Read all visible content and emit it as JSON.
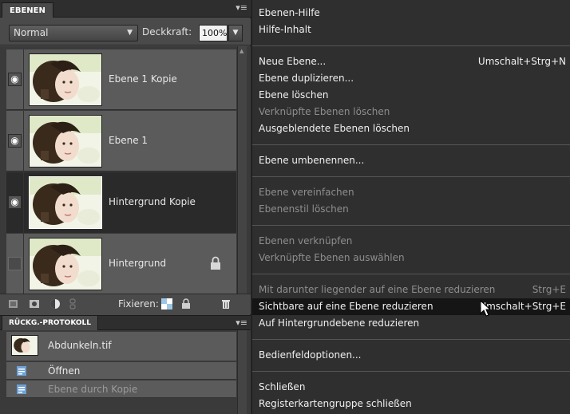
{
  "layers_panel": {
    "tab_label": "EBENEN",
    "menu_glyph": "▾≡",
    "blend_mode": "Normal",
    "opacity_label": "Deckkraft:",
    "opacity_value": "100%",
    "layers": [
      {
        "name": "Ebene 1 Kopie",
        "visible": true,
        "selected": false,
        "locked": false
      },
      {
        "name": "Ebene 1",
        "visible": true,
        "selected": false,
        "locked": false
      },
      {
        "name": "Hintergrund Kopie",
        "visible": true,
        "selected": true,
        "locked": false
      },
      {
        "name": "Hintergrund",
        "visible": false,
        "selected": false,
        "locked": true
      }
    ],
    "lock_label": "Fixieren:"
  },
  "history_panel": {
    "tab_label": "RÜCKG.-PROTOKOLL",
    "menu_glyph": "▾≡",
    "snapshot": "Abdunkeln.tif",
    "items": [
      "Öffnen",
      "Ebene durch Kopie"
    ]
  },
  "context_menu": {
    "groups": [
      [
        {
          "label": "Ebenen-Hilfe",
          "shortcut": "",
          "enabled": true
        },
        {
          "label": "Hilfe-Inhalt",
          "shortcut": "",
          "enabled": true
        }
      ],
      [
        {
          "label": "Neue Ebene...",
          "shortcut": "Umschalt+Strg+N",
          "enabled": true
        },
        {
          "label": "Ebene duplizieren...",
          "shortcut": "",
          "enabled": true
        },
        {
          "label": "Ebene löschen",
          "shortcut": "",
          "enabled": true
        },
        {
          "label": "Verknüpfte Ebenen löschen",
          "shortcut": "",
          "enabled": false
        },
        {
          "label": "Ausgeblendete Ebenen löschen",
          "shortcut": "",
          "enabled": true
        }
      ],
      [
        {
          "label": "Ebene umbenennen...",
          "shortcut": "",
          "enabled": true
        }
      ],
      [
        {
          "label": "Ebene vereinfachen",
          "shortcut": "",
          "enabled": false
        },
        {
          "label": "Ebenenstil löschen",
          "shortcut": "",
          "enabled": false
        }
      ],
      [
        {
          "label": "Ebenen verknüpfen",
          "shortcut": "",
          "enabled": false
        },
        {
          "label": "Verknüpfte Ebenen auswählen",
          "shortcut": "",
          "enabled": false
        }
      ],
      [
        {
          "label": "Mit darunter liegender auf eine Ebene reduzieren",
          "shortcut": "Strg+E",
          "enabled": false
        },
        {
          "label": "Sichtbare auf eine Ebene reduzieren",
          "shortcut": "Umschalt+Strg+E",
          "enabled": true,
          "highlighted": true
        },
        {
          "label": "Auf Hintergrundebene reduzieren",
          "shortcut": "",
          "enabled": true
        }
      ],
      [
        {
          "label": "Bedienfeldoptionen...",
          "shortcut": "",
          "enabled": true
        }
      ],
      [
        {
          "label": "Schließen",
          "shortcut": "",
          "enabled": true
        },
        {
          "label": "Registerkartengruppe schließen",
          "shortcut": "",
          "enabled": true
        }
      ]
    ]
  }
}
